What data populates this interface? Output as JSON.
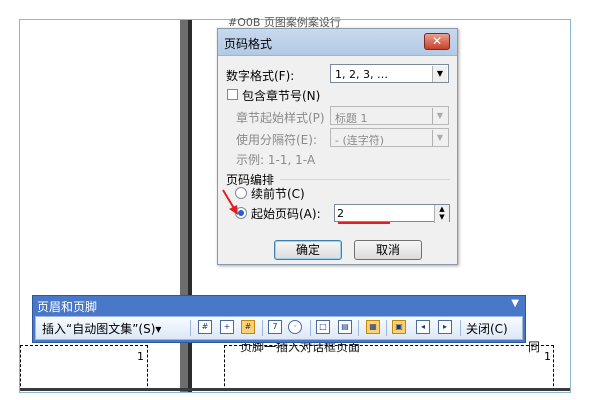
{
  "document": {
    "clipped_top_text": "#O0B 页图案例案设行",
    "footer_left_num": "1",
    "footer_right_num": "1",
    "behind_text": "页脚一插入对话框页面",
    "behind_text_right": "同"
  },
  "dialog": {
    "title": "页码格式",
    "close_label": "✕",
    "number_format_label": "数字格式(F):",
    "number_format_value": "1, 2, 3, …",
    "include_chapter_label": "包含章节号(N)",
    "chapter_style_label": "章节起始样式(P)",
    "chapter_style_value": "标题 1",
    "separator_label": "使用分隔符(E):",
    "separator_value": "-  (连字符)",
    "example_label": "示例:  1-1, 1-A",
    "numbering_group_label": "页码编排",
    "continue_label": "续前节(C)",
    "start_at_label": "起始页码(A):",
    "start_at_value": "2",
    "ok_label": "确定",
    "cancel_label": "取消"
  },
  "toolbar": {
    "title": "页眉和页脚",
    "dropdown_icon": "▼",
    "insert_autotext_label": "插入“自动图文集”(S)▾",
    "close_label": "关闭(C)",
    "icons": [
      "insert-page-number-icon",
      "insert-page-count-icon",
      "format-page-number-icon",
      "insert-date-icon",
      "insert-time-icon",
      "page-setup-icon",
      "show-hide-text-icon",
      "same-as-previous-icon",
      "switch-header-footer-icon",
      "show-previous-icon",
      "show-next-icon"
    ]
  },
  "colors": {
    "toolbar_blue": "#4a78c8",
    "accent_red": "#e02020",
    "radio_selected": "#2a5bd7"
  }
}
